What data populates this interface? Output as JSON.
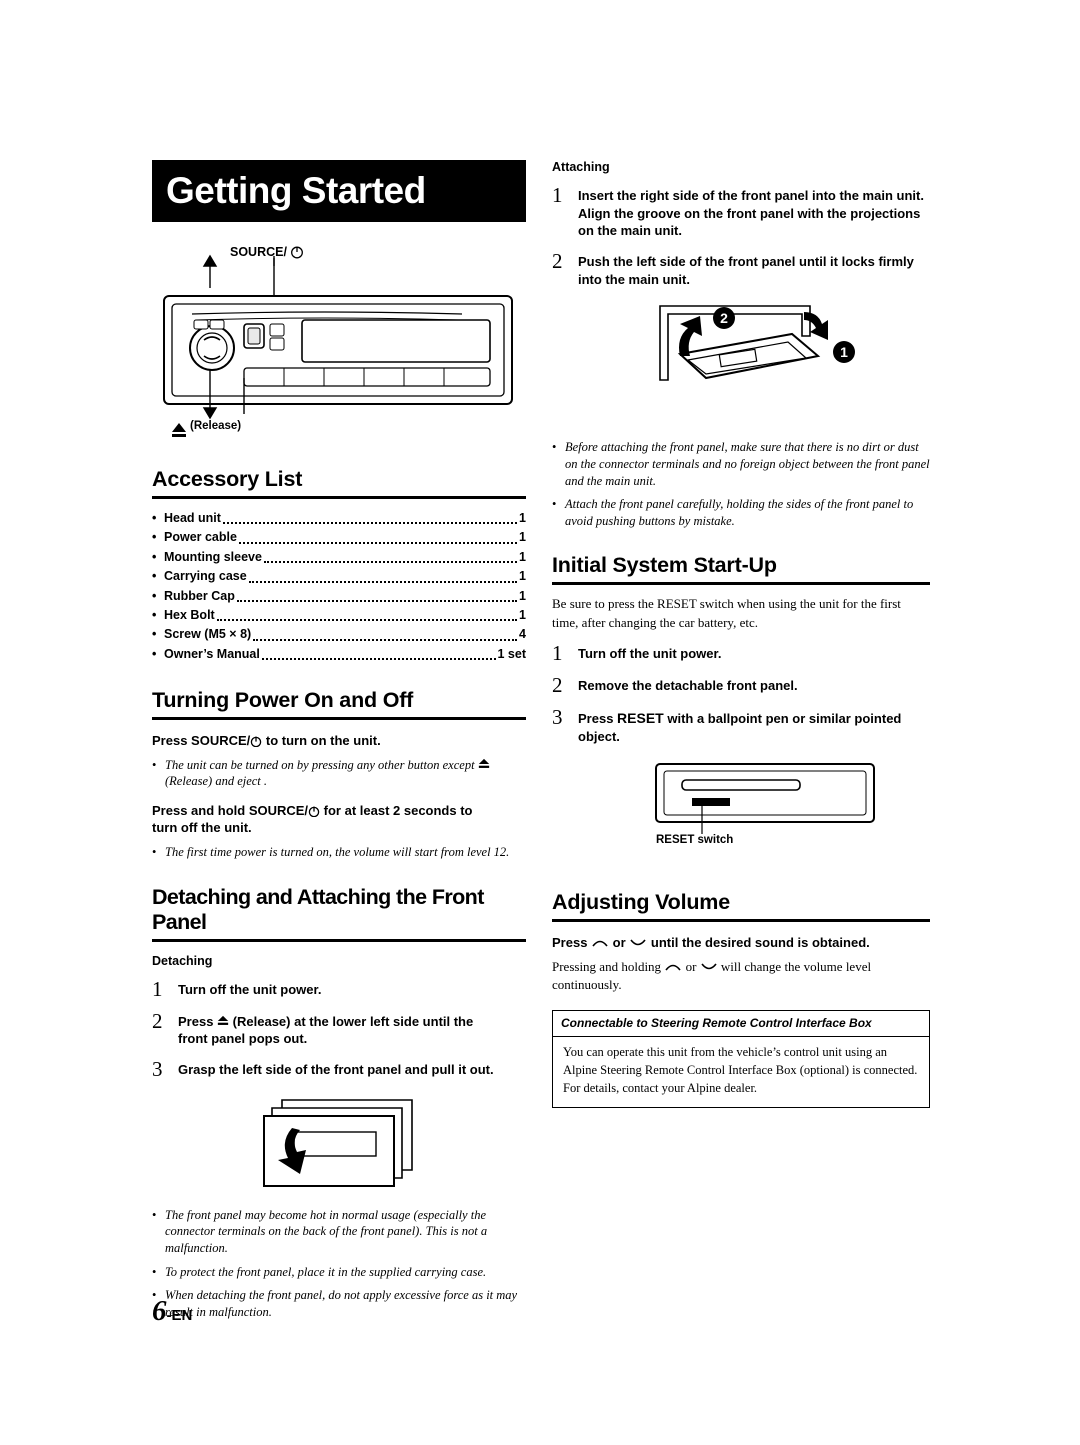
{
  "page": {
    "title": "Getting Started",
    "number": "6",
    "number_suffix": "-EN"
  },
  "headunit_figure": {
    "source_label": "SOURCE/",
    "source_power_glyph": "⏻",
    "release_label": "(Release)",
    "release_glyph": "⏏"
  },
  "accessory": {
    "heading": "Accessory List",
    "items": [
      {
        "name": "Head unit",
        "qty": "1"
      },
      {
        "name": "Power cable",
        "qty": "1"
      },
      {
        "name": "Mounting sleeve",
        "qty": "1"
      },
      {
        "name": "Carrying case",
        "qty": "1"
      },
      {
        "name": "Rubber Cap",
        "qty": "1"
      },
      {
        "name": "Hex Bolt",
        "qty": "1"
      },
      {
        "name": "Screw (M5 × 8)",
        "qty": "4"
      },
      {
        "name": "Owner’s Manual",
        "qty": "1 set"
      }
    ]
  },
  "power": {
    "heading": "Turning Power On and Off",
    "line1_pre": "Press ",
    "line1_src": "SOURCE/",
    "line1_post": " to turn on the unit.",
    "note1": "The unit can be turned on by pressing any other button except",
    "note1b": " (Release) and eject  .",
    "line2_pre": "Press and hold ",
    "line2_src": "SOURCE/",
    "line2_post": " for at least 2 seconds to",
    "line2_b": "turn off the unit.",
    "note2": "The first time power is turned on, the volume will start from level 12."
  },
  "detach": {
    "heading": "Detaching and Attaching the Front Panel",
    "sub_detaching": "Detaching",
    "steps": [
      {
        "n": "1",
        "text": "Turn off the unit power."
      },
      {
        "n": "2",
        "text": "Press   (Release) at the lower left side until the front panel pops out."
      },
      {
        "n": "3",
        "text": "Grasp the left side of the front panel and pull it out."
      }
    ],
    "step2_pre": "Press ",
    "step2_mid": "(Release)",
    "step2_post": " at the lower left side until the",
    "step2_line2": "front panel pops out.",
    "notes": [
      "The front panel may become hot in normal usage (especially the connector terminals on the back of the front panel). This is not a malfunction.",
      "To protect the front panel, place it in the supplied carrying case.",
      "When detaching the front panel, do not apply excessive force as it may result in malfunction."
    ]
  },
  "attach": {
    "sub_attaching": "Attaching",
    "steps": [
      {
        "n": "1",
        "text": "Insert the right side of the front panel into the main unit. Align the groove on the front panel with the projections on the main unit."
      },
      {
        "n": "2",
        "text": "Push the left side of the front panel until it locks firmly into the main unit."
      }
    ],
    "fig_labels": {
      "one": "1",
      "two": "2"
    },
    "notes": [
      "Before attaching the front panel, make sure that there is no dirt or dust on the connector terminals and no foreign object between the front panel and the main unit.",
      "Attach the front panel carefully, holding the sides of the front panel to avoid pushing buttons by mistake."
    ]
  },
  "startup": {
    "heading": "Initial System Start-Up",
    "intro": "Be sure to press the RESET switch when using the unit for the first time, after changing the car battery, etc.",
    "steps": [
      {
        "n": "1",
        "text": "Turn off the unit power."
      },
      {
        "n": "2",
        "text": "Remove the detachable front panel."
      },
      {
        "n": "3",
        "text": "Press RESET with a ballpoint pen or similar pointed object."
      }
    ],
    "step3_pre": "Press ",
    "step3_reset": "RESET",
    "step3_post": " with a ballpoint pen or similar pointed",
    "step3_line2": "object.",
    "reset_switch_label": "RESET switch"
  },
  "volume": {
    "heading": "Adjusting Volume",
    "line_pre": "Press ",
    "line_or": " or ",
    "line_post": " until the desired sound is obtained.",
    "body_pre": "Pressing and holding ",
    "body_or": " or ",
    "body_post": " will change the volume level",
    "body_line2": "continuously."
  },
  "callout": {
    "heading": "Connectable to Steering Remote Control Interface Box",
    "body": "You can operate this unit from the vehicle’s control unit using an Alpine Steering Remote Control Interface Box (optional) is connected. For details, contact your Alpine dealer."
  }
}
